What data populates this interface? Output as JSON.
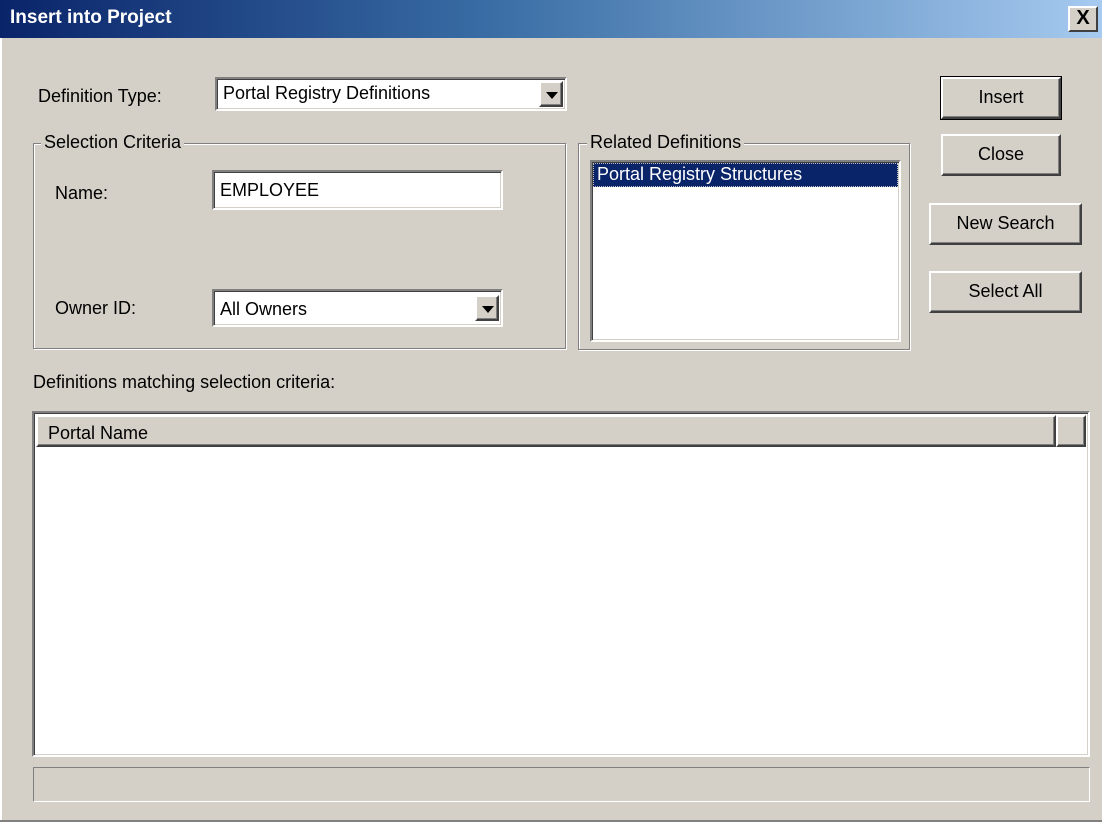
{
  "window": {
    "title": "Insert into Project",
    "close_label": "X"
  },
  "definition_type": {
    "label": "Definition Type:",
    "value": "Portal Registry Definitions"
  },
  "selection_criteria": {
    "legend": "Selection Criteria",
    "name_label": "Name:",
    "name_value": "EMPLOYEE",
    "owner_label": "Owner ID:",
    "owner_value": "All Owners"
  },
  "related_definitions": {
    "legend": "Related Definitions",
    "items": [
      {
        "label": "Portal Registry Structures",
        "selected": true
      }
    ]
  },
  "buttons": {
    "insert": "Insert",
    "close": "Close",
    "new_search": "New Search",
    "select_all": "Select All"
  },
  "results": {
    "caption": "Definitions matching selection criteria:",
    "columns": [
      "Portal Name"
    ],
    "rows": []
  },
  "colors": {
    "selection_bg": "#0a246a",
    "dialog_bg": "#d4d0c8"
  }
}
